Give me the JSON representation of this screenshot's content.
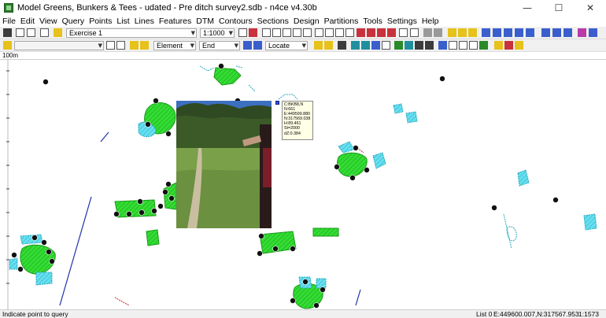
{
  "window": {
    "title": "Model Greens, Bunkers & Tees - udated - Pre ditch survey2.sdb - n4ce v4.30b",
    "minimize_icon": "minimize-icon",
    "maximize_icon": "maximize-icon",
    "close_icon": "close-icon"
  },
  "menu": [
    "File",
    "Edit",
    "View",
    "Query",
    "Points",
    "List",
    "Lines",
    "Features",
    "DTM",
    "Contours",
    "Sections",
    "Design",
    "Partitions",
    "Tools",
    "Settings",
    "Help"
  ],
  "toolbar": {
    "exercise_value": "Exercise 1",
    "scale_value": "1:1000",
    "element_value": "Element",
    "end_value": "End",
    "locate_value": "Locate"
  },
  "ruler": {
    "label": "100m"
  },
  "tooltip": {
    "lines": [
      "C:BKB8,N",
      "N:661",
      "E:449599.880",
      "N:317569.038",
      "H:89.461",
      "St=2000",
      "dZ:0.384"
    ]
  },
  "status": {
    "message": "Indicate point to query",
    "list": "List 0",
    "coords": "E:449600.007,N:317567.953",
    "scale": "1:1573"
  },
  "colors": {
    "green_fill": "#33dd33",
    "bunker_fill": "#66e0f0",
    "line_blue": "#2233aa",
    "accent_red": "#cc2222"
  }
}
